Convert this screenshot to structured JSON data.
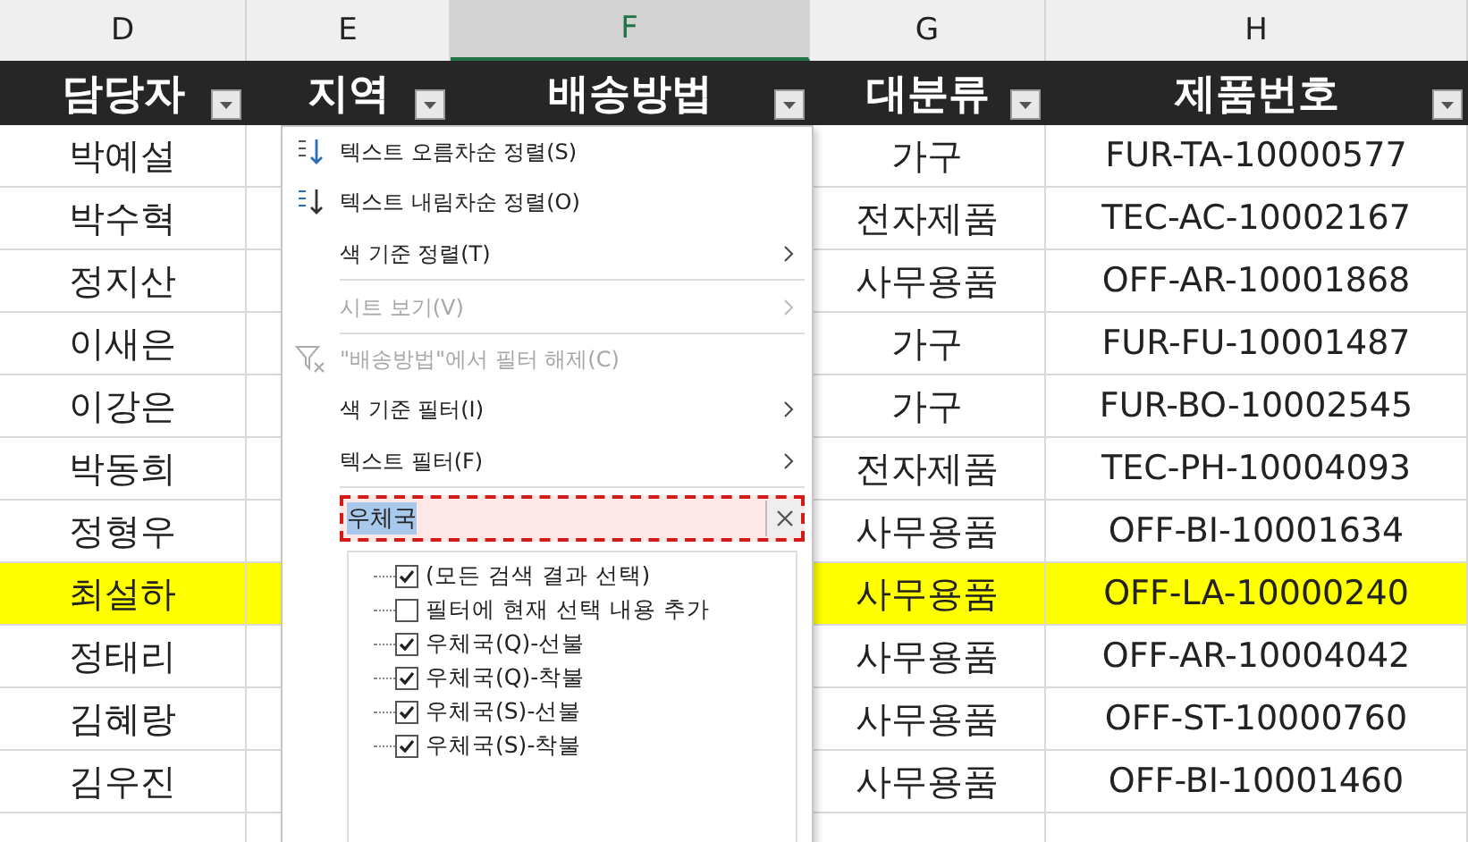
{
  "column_letters": [
    {
      "label": "D",
      "selected": false
    },
    {
      "label": "E",
      "selected": false
    },
    {
      "label": "F",
      "selected": true
    },
    {
      "label": "G",
      "selected": false
    },
    {
      "label": "H",
      "selected": false
    }
  ],
  "headers": [
    "담당자",
    "지역",
    "배송방법",
    "대분류",
    "제품번호"
  ],
  "rows": [
    {
      "manager": "박예설",
      "category": "가구",
      "product_id": "FUR-TA-10000577",
      "highlighted": false
    },
    {
      "manager": "박수혁",
      "category": "전자제품",
      "product_id": "TEC-AC-10002167",
      "highlighted": false
    },
    {
      "manager": "정지산",
      "category": "사무용품",
      "product_id": "OFF-AR-10001868",
      "highlighted": false
    },
    {
      "manager": "이새은",
      "category": "가구",
      "product_id": "FUR-FU-10001487",
      "highlighted": false
    },
    {
      "manager": "이강은",
      "category": "가구",
      "product_id": "FUR-BO-10002545",
      "highlighted": false
    },
    {
      "manager": "박동희",
      "category": "전자제품",
      "product_id": "TEC-PH-10004093",
      "highlighted": false
    },
    {
      "manager": "정형우",
      "category": "사무용품",
      "product_id": "OFF-BI-10001634",
      "highlighted": false
    },
    {
      "manager": "최설하",
      "category": "사무용품",
      "product_id": "OFF-LA-10000240",
      "highlighted": true
    },
    {
      "manager": "정태리",
      "category": "사무용품",
      "product_id": "OFF-AR-10004042",
      "highlighted": false
    },
    {
      "manager": "김혜랑",
      "category": "사무용품",
      "product_id": "OFF-ST-10000760",
      "highlighted": false
    },
    {
      "manager": "김우진",
      "category": "사무용품",
      "product_id": "OFF-BI-10001460",
      "highlighted": false
    }
  ],
  "filter_menu": {
    "items": [
      {
        "kind": "sort-ascending",
        "label": "텍스트 오름차순 정렬(S)",
        "disabled": false,
        "submenu": false,
        "separator_after": false
      },
      {
        "kind": "sort-descending",
        "label": "텍스트 내림차순 정렬(O)",
        "disabled": false,
        "submenu": false,
        "separator_after": false
      },
      {
        "kind": "plain",
        "label": "색 기준 정렬(T)",
        "disabled": false,
        "submenu": true,
        "separator_after": true
      },
      {
        "kind": "plain",
        "label": "시트 보기(V)",
        "disabled": true,
        "submenu": true,
        "separator_after": true
      },
      {
        "kind": "clear-filter",
        "label": "\"배송방법\"에서 필터 해제(C)",
        "disabled": true,
        "submenu": false,
        "separator_after": false
      },
      {
        "kind": "plain",
        "label": "색 기준 필터(I)",
        "disabled": false,
        "submenu": true,
        "separator_after": false
      },
      {
        "kind": "plain",
        "label": "텍스트 필터(F)",
        "disabled": false,
        "submenu": true,
        "separator_after": true
      }
    ],
    "search": {
      "value": "우체국"
    },
    "options": [
      {
        "label": "(모든 검색 결과 선택)",
        "checked": true
      },
      {
        "label": "필터에 현재 선택 내용 추가",
        "checked": false
      },
      {
        "label": "우체국(Q)-선불",
        "checked": true
      },
      {
        "label": "우체국(Q)-착불",
        "checked": true
      },
      {
        "label": "우체국(S)-선불",
        "checked": true
      },
      {
        "label": "우체국(S)-착불",
        "checked": true
      }
    ]
  }
}
